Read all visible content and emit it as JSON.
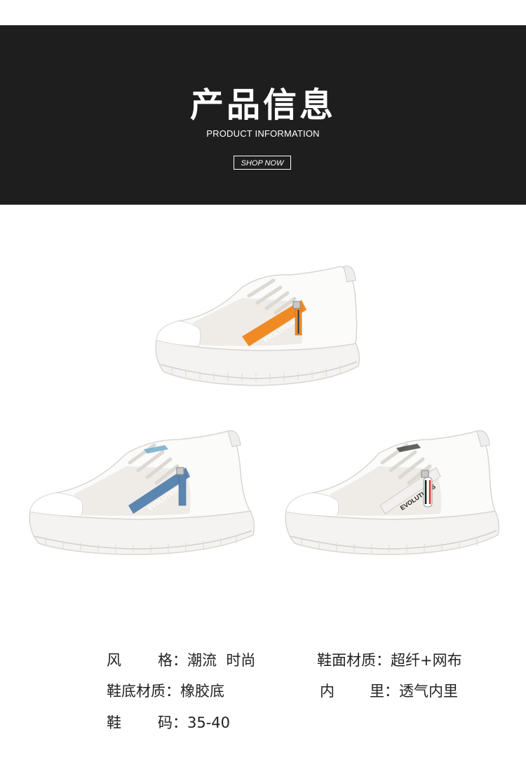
{
  "header": {
    "title": "产品信息",
    "subtitle": "PRODUCT INFORMATION",
    "shop_button": "SHOP NOW"
  },
  "products": [
    {
      "accent_color": "#f08a24",
      "strap_text": "EVOLUTIONS"
    },
    {
      "accent_color": "#5b86b0",
      "strap_text": "EVOLUTIONS"
    },
    {
      "accent_color": "#ffffff",
      "strap_text": "EVOLUTIONS"
    }
  ],
  "specs": {
    "style_label_1": "风",
    "style_label_2": "格",
    "style_value": "潮流  时尚",
    "upper_label": "鞋面材质",
    "upper_value": "超纤+网布",
    "sole_label": "鞋底材质",
    "sole_value": "橡胶底",
    "lining_label_1": "内",
    "lining_label_2": "里",
    "lining_value": "透气内里",
    "size_label_1": "鞋",
    "size_label_2": "码",
    "size_value": "35-40",
    "colon": "："
  },
  "colors": {
    "banner_bg": "#1f1e1e",
    "orange": "#f08a24",
    "blue": "#5b86b0",
    "text": "#222222"
  }
}
